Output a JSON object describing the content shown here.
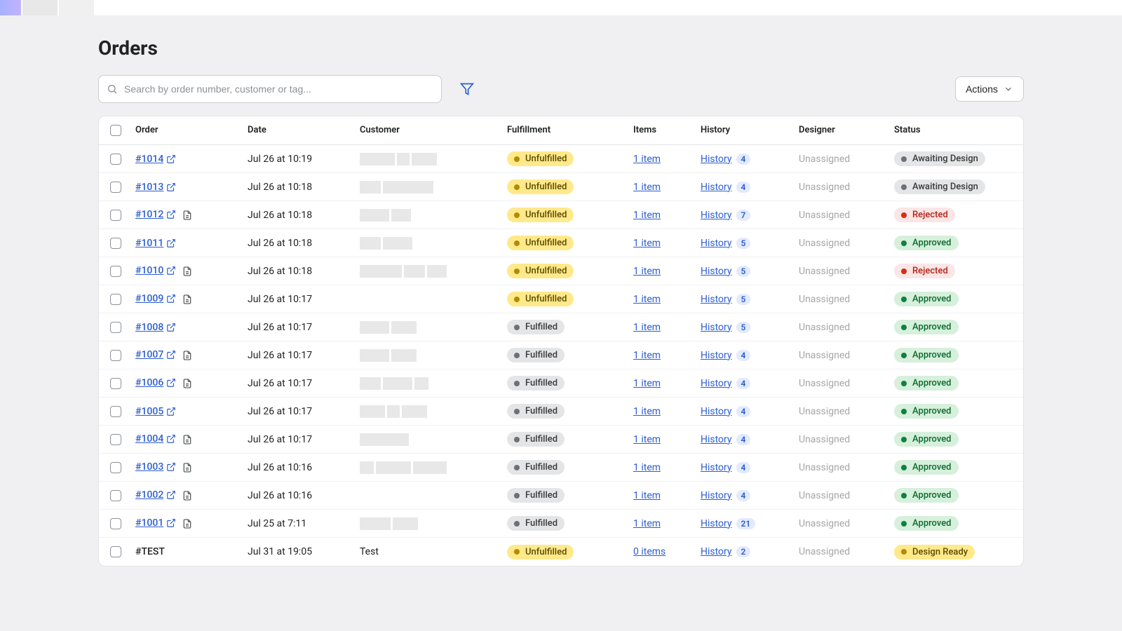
{
  "page_title": "Orders",
  "search": {
    "placeholder": "Search by order number, customer or tag..."
  },
  "actions_label": "Actions",
  "columns": {
    "order": "Order",
    "date": "Date",
    "customer": "Customer",
    "fulfillment": "Fulfillment",
    "items": "Items",
    "history": "History",
    "designer": "Designer",
    "status": "Status"
  },
  "history_label": "History",
  "rows": [
    {
      "order": "#1014",
      "link": true,
      "note": false,
      "date": "Jul 26 at 10:19",
      "customer_redacted": [
        50,
        18,
        36
      ],
      "customer_text": "",
      "fulfillment": "Unfulfilled",
      "fulfill_class": "unfulfilled",
      "items": "1 item",
      "history_count": "4",
      "designer": "Unassigned",
      "status": "Awaiting Design",
      "status_class": "awaiting"
    },
    {
      "order": "#1013",
      "link": true,
      "note": false,
      "date": "Jul 26 at 10:18",
      "customer_redacted": [
        30,
        72
      ],
      "customer_text": "",
      "fulfillment": "Unfulfilled",
      "fulfill_class": "unfulfilled",
      "items": "1 item",
      "history_count": "4",
      "designer": "Unassigned",
      "status": "Awaiting Design",
      "status_class": "awaiting"
    },
    {
      "order": "#1012",
      "link": true,
      "note": true,
      "date": "Jul 26 at 10:18",
      "customer_redacted": [
        42,
        28
      ],
      "customer_text": "",
      "fulfillment": "Unfulfilled",
      "fulfill_class": "unfulfilled",
      "items": "1 item",
      "history_count": "7",
      "designer": "Unassigned",
      "status": "Rejected",
      "status_class": "rejected"
    },
    {
      "order": "#1011",
      "link": true,
      "note": false,
      "date": "Jul 26 at 10:18",
      "customer_redacted": [
        30,
        42
      ],
      "customer_text": "",
      "fulfillment": "Unfulfilled",
      "fulfill_class": "unfulfilled",
      "items": "1 item",
      "history_count": "5",
      "designer": "Unassigned",
      "status": "Approved",
      "status_class": "approved"
    },
    {
      "order": "#1010",
      "link": true,
      "note": true,
      "date": "Jul 26 at 10:18",
      "customer_redacted": [
        60,
        30,
        28
      ],
      "customer_text": "",
      "fulfillment": "Unfulfilled",
      "fulfill_class": "unfulfilled",
      "items": "1 item",
      "history_count": "5",
      "designer": "Unassigned",
      "status": "Rejected",
      "status_class": "rejected"
    },
    {
      "order": "#1009",
      "link": true,
      "note": true,
      "date": "Jul 26 at 10:17",
      "customer_redacted": [],
      "customer_text": "",
      "fulfillment": "Unfulfilled",
      "fulfill_class": "unfulfilled",
      "items": "1 item",
      "history_count": "5",
      "designer": "Unassigned",
      "status": "Approved",
      "status_class": "approved"
    },
    {
      "order": "#1008",
      "link": true,
      "note": false,
      "date": "Jul 26 at 10:17",
      "customer_redacted": [
        42,
        36
      ],
      "customer_text": "",
      "fulfillment": "Fulfilled",
      "fulfill_class": "fulfilled",
      "items": "1 item",
      "history_count": "5",
      "designer": "Unassigned",
      "status": "Approved",
      "status_class": "approved"
    },
    {
      "order": "#1007",
      "link": true,
      "note": true,
      "date": "Jul 26 at 10:17",
      "customer_redacted": [
        42,
        36
      ],
      "customer_text": "",
      "fulfillment": "Fulfilled",
      "fulfill_class": "fulfilled",
      "items": "1 item",
      "history_count": "4",
      "designer": "Unassigned",
      "status": "Approved",
      "status_class": "approved"
    },
    {
      "order": "#1006",
      "link": true,
      "note": true,
      "date": "Jul 26 at 10:17",
      "customer_redacted": [
        30,
        42,
        20
      ],
      "customer_text": "",
      "fulfillment": "Fulfilled",
      "fulfill_class": "fulfilled",
      "items": "1 item",
      "history_count": "4",
      "designer": "Unassigned",
      "status": "Approved",
      "status_class": "approved"
    },
    {
      "order": "#1005",
      "link": true,
      "note": false,
      "date": "Jul 26 at 10:17",
      "customer_redacted": [
        36,
        18,
        36
      ],
      "customer_text": "",
      "fulfillment": "Fulfilled",
      "fulfill_class": "fulfilled",
      "items": "1 item",
      "history_count": "4",
      "designer": "Unassigned",
      "status": "Approved",
      "status_class": "approved"
    },
    {
      "order": "#1004",
      "link": true,
      "note": true,
      "date": "Jul 26 at 10:17",
      "customer_redacted": [
        70
      ],
      "customer_text": "",
      "fulfillment": "Fulfilled",
      "fulfill_class": "fulfilled",
      "items": "1 item",
      "history_count": "4",
      "designer": "Unassigned",
      "status": "Approved",
      "status_class": "approved"
    },
    {
      "order": "#1003",
      "link": true,
      "note": true,
      "date": "Jul 26 at 10:16",
      "customer_redacted": [
        20,
        50,
        48
      ],
      "customer_text": "",
      "fulfillment": "Fulfilled",
      "fulfill_class": "fulfilled",
      "items": "1 item",
      "history_count": "4",
      "designer": "Unassigned",
      "status": "Approved",
      "status_class": "approved"
    },
    {
      "order": "#1002",
      "link": true,
      "note": true,
      "date": "Jul 26 at 10:16",
      "customer_redacted": [],
      "customer_text": "",
      "fulfillment": "Fulfilled",
      "fulfill_class": "fulfilled",
      "items": "1 item",
      "history_count": "4",
      "designer": "Unassigned",
      "status": "Approved",
      "status_class": "approved"
    },
    {
      "order": "#1001",
      "link": true,
      "note": true,
      "date": "Jul 25 at 7:11",
      "customer_redacted": [
        44,
        36
      ],
      "customer_text": "",
      "fulfillment": "Fulfilled",
      "fulfill_class": "fulfilled",
      "items": "1 item",
      "history_count": "21",
      "designer": "Unassigned",
      "status": "Approved",
      "status_class": "approved"
    },
    {
      "order": "#TEST",
      "link": false,
      "note": false,
      "date": "Jul 31 at 19:05",
      "customer_redacted": [],
      "customer_text": "Test",
      "fulfillment": "Unfulfilled",
      "fulfill_class": "unfulfilled",
      "items": "0 items",
      "history_count": "2",
      "designer": "Unassigned",
      "status": "Design Ready",
      "status_class": "ready"
    }
  ]
}
